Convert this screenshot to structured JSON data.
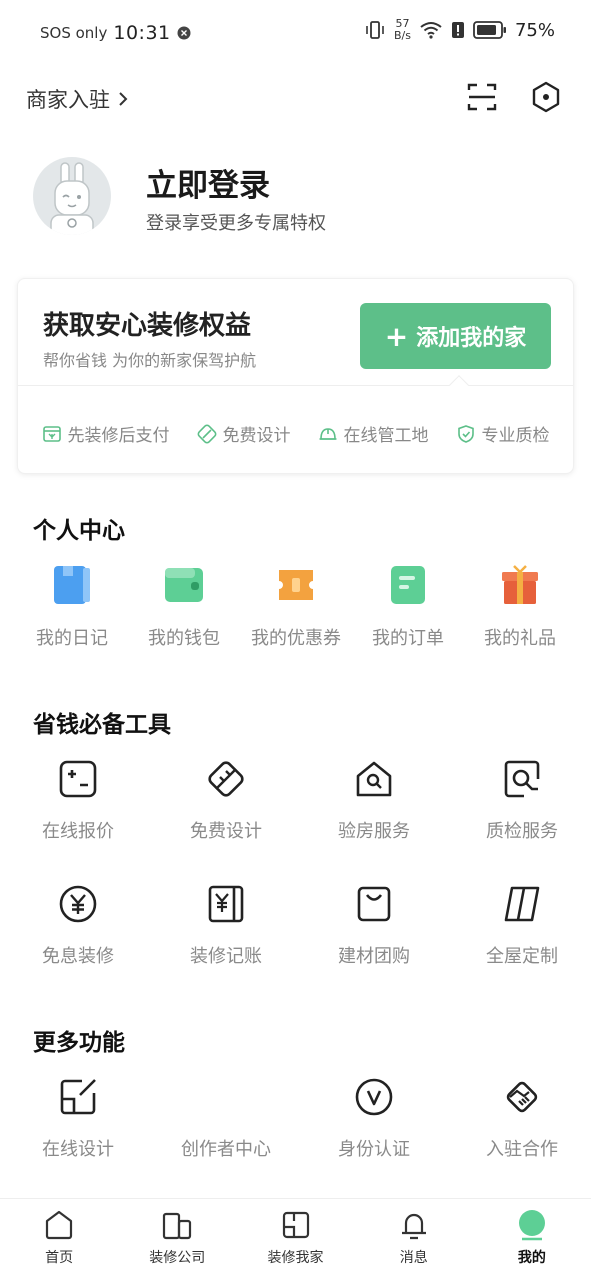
{
  "status_bar": {
    "sos": "SOS only",
    "time": "10:31",
    "speed_top": "57",
    "speed_bottom": "B/s",
    "battery": "75%"
  },
  "header": {
    "merchant_label": "商家入驻",
    "icons": [
      "scan-icon",
      "settings-hexagon-icon"
    ]
  },
  "profile": {
    "title": "立即登录",
    "subtitle": "登录享受更多专属特权"
  },
  "benefit_card": {
    "title": "获取安心装修权益",
    "subtitle": "帮你省钱  为你的新家保驾护航",
    "button_label": "添加我的家",
    "features": [
      {
        "label": "先装修后支付",
        "icon": "payment-icon"
      },
      {
        "label": "免费设计",
        "icon": "design-icon"
      },
      {
        "label": "在线管工地",
        "icon": "helmet-icon"
      },
      {
        "label": "专业质检",
        "icon": "shield-check-icon"
      }
    ],
    "accent": "#5dbf89"
  },
  "personal_center": {
    "title": "个人中心",
    "items": [
      {
        "label": "我的日记",
        "icon": "diary-icon",
        "color": "#4c9ff0"
      },
      {
        "label": "我的钱包",
        "icon": "wallet-icon",
        "color": "#5dcf95"
      },
      {
        "label": "我的优惠券",
        "icon": "coupon-icon",
        "color": "#f3a23f"
      },
      {
        "label": "我的订单",
        "icon": "order-icon",
        "color": "#5dcf95"
      },
      {
        "label": "我的礼品",
        "icon": "gift-icon",
        "color": "#ee6a44"
      }
    ]
  },
  "tools": {
    "title": "省钱必备工具",
    "items": [
      {
        "label": "在线报价",
        "icon": "calculator-icon"
      },
      {
        "label": "免费设计",
        "icon": "ruler-design-icon"
      },
      {
        "label": "验房服务",
        "icon": "house-search-icon"
      },
      {
        "label": "质检服务",
        "icon": "quality-check-icon"
      },
      {
        "label": "免息装修",
        "icon": "yuan-circle-icon"
      },
      {
        "label": "装修记账",
        "icon": "ledger-icon"
      },
      {
        "label": "建材团购",
        "icon": "shopping-bag-icon"
      },
      {
        "label": "全屋定制",
        "icon": "custom-cabinet-icon"
      }
    ]
  },
  "more": {
    "title": "更多功能",
    "items": [
      {
        "label": "在线设计",
        "icon": "edit-design-icon"
      },
      {
        "label": "创作者中心",
        "icon": "creator-icon"
      },
      {
        "label": "身份认证",
        "icon": "verify-v-icon"
      },
      {
        "label": "入驻合作",
        "icon": "handshake-icon"
      }
    ]
  },
  "tabbar": {
    "tabs": [
      {
        "label": "首页",
        "icon": "home-icon"
      },
      {
        "label": "装修公司",
        "icon": "company-icon"
      },
      {
        "label": "装修我家",
        "icon": "my-home-icon"
      },
      {
        "label": "消息",
        "icon": "bell-icon"
      },
      {
        "label": "我的",
        "icon": "profile-dot-icon",
        "active": true
      }
    ]
  }
}
